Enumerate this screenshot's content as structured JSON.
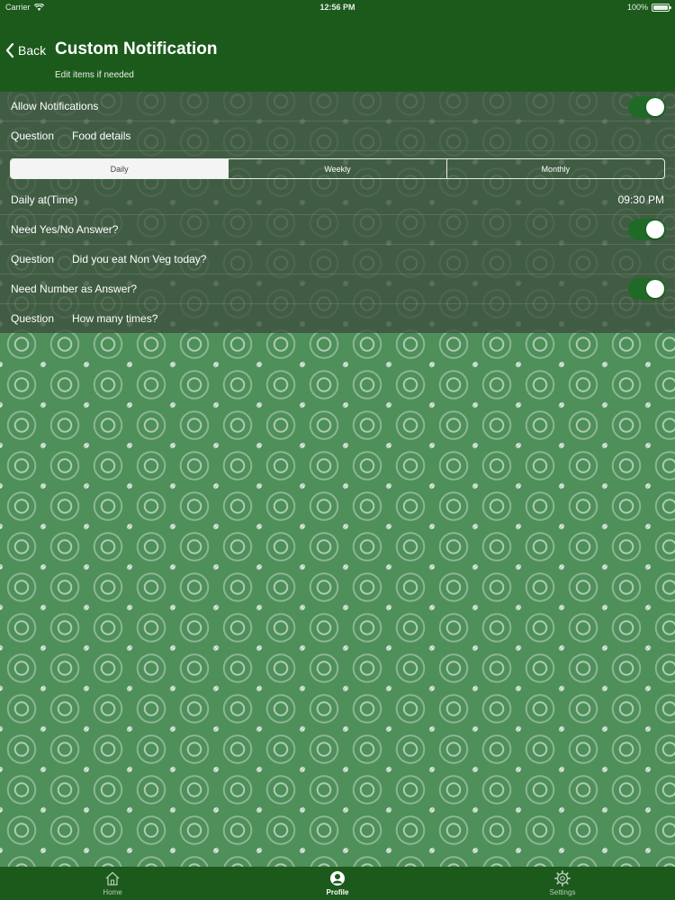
{
  "status_bar": {
    "carrier": "Carrier",
    "time": "12:56 PM",
    "battery": "100%"
  },
  "nav": {
    "back_label": "Back",
    "title": "Custom Notification",
    "subtitle": "Edit items if needed"
  },
  "settings": {
    "allow_notifications": {
      "label": "Allow Notifications",
      "on": true
    },
    "question_1": {
      "label": "Question",
      "value": "Food details"
    },
    "frequency": {
      "options": [
        "Daily",
        "Weekly",
        "Monthly"
      ],
      "selected": "Daily"
    },
    "daily_time": {
      "label": "Daily at(Time)",
      "value": "09:30 PM"
    },
    "need_yes_no": {
      "label": "Need Yes/No Answer?",
      "on": true
    },
    "question_2": {
      "label": "Question",
      "value": "Did you eat Non Veg today?"
    },
    "need_number": {
      "label": "Need Number as Answer?",
      "on": true
    },
    "question_3": {
      "label": "Question",
      "value": "How many times?"
    }
  },
  "tabs": [
    {
      "label": "Home",
      "icon": "home-icon",
      "active": false
    },
    {
      "label": "Profile",
      "icon": "profile-icon",
      "active": true
    },
    {
      "label": "Settings",
      "icon": "gear-icon",
      "active": false
    }
  ],
  "colors": {
    "header": "#1c5a1c",
    "toggle_on": "#1f6a26",
    "background": "#4e8f5a"
  }
}
